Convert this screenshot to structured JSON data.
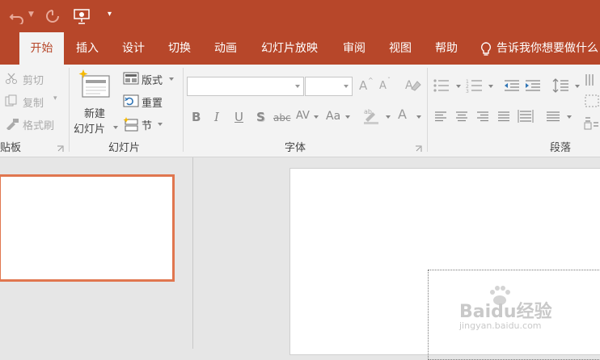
{
  "quick_access": {
    "undo_icon": "undo-icon",
    "redo_icon": "repeat-icon",
    "present_icon": "slideshow-from-start-icon",
    "customize_icon": "customize-qat-icon"
  },
  "tabs": [
    "开始",
    "插入",
    "设计",
    "切换",
    "动画",
    "幻灯片放映",
    "审阅",
    "视图",
    "帮助"
  ],
  "tell_me": "告诉我你想要做什么",
  "clipboard": {
    "cut": "剪切",
    "copy": "复制",
    "format_painter": "格式刷",
    "label": "贴板"
  },
  "slides": {
    "new_slide_line1": "新建",
    "new_slide_line2": "幻灯片",
    "layout": "版式",
    "reset": "重置",
    "section": "节",
    "label": "幻灯片"
  },
  "font": {
    "label": "字体",
    "font_name": "",
    "font_size": "",
    "bold": "B",
    "italic": "I",
    "underline": "U",
    "shadow": "S",
    "strike": "abc",
    "spacing": "AV",
    "change_case": "Aa",
    "grow": "A",
    "shrink": "A",
    "font_color": "A"
  },
  "paragraph": {
    "label": "段落"
  },
  "watermark": {
    "brand": "Baidu经验",
    "url": "jingyan.baidu.com"
  },
  "colors": {
    "accent": "#b7472a",
    "thumb_border": "#e0764f"
  }
}
